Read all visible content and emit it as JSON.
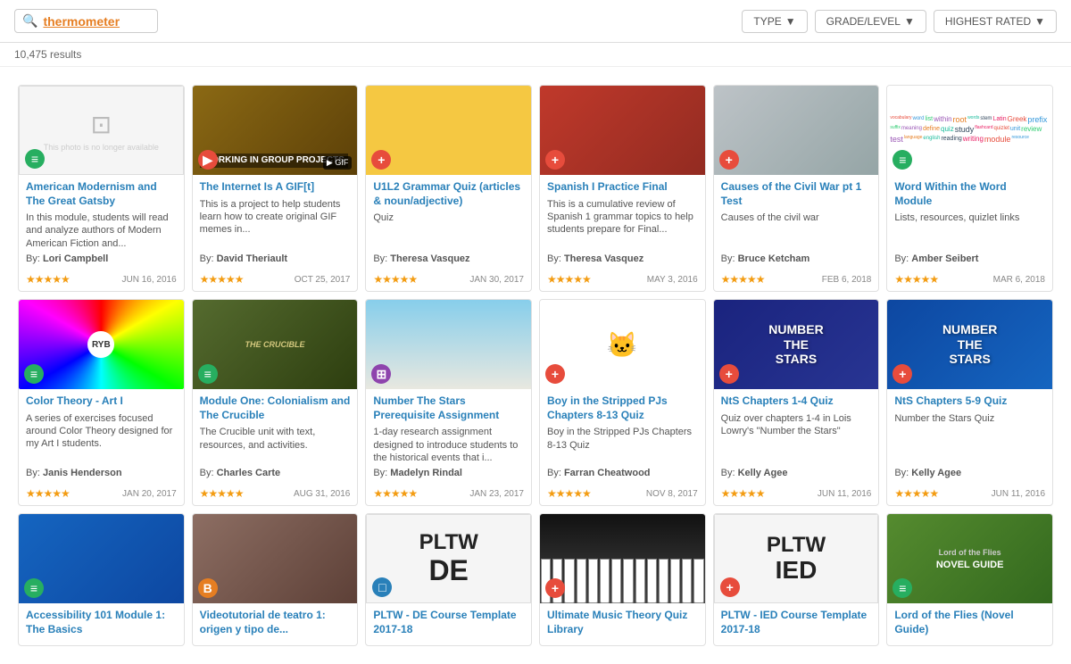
{
  "header": {
    "search_label": "thermometer",
    "search_icon": "🔍",
    "filters": [
      {
        "label": "TYPE",
        "icon": "▼"
      },
      {
        "label": "GRADE/LEVEL",
        "icon": "▼"
      },
      {
        "label": "HIGHEST RATED",
        "icon": "▼"
      }
    ]
  },
  "results_count": "10,475 results",
  "cards": [
    {
      "id": "card-1",
      "title": "American Modernism and The Great Gatsby",
      "desc": "In this module, students will read and analyze authors of Modern American Fiction and...",
      "author": "Lori Campbell",
      "date": "JUN 16, 2016",
      "stars": 5,
      "badge_type": "green",
      "badge_icon": "≡",
      "thumb_type": "no-image",
      "row": 1
    },
    {
      "id": "card-2",
      "title": "The Internet Is A GIF[t]",
      "desc": "This is a project to help students learn how to create original GIF memes in...",
      "author": "David Theriault",
      "date": "OCT 25, 2017",
      "stars": 5,
      "badge_type": "red",
      "badge_icon": "▶",
      "thumb_type": "brown",
      "thumb_text": "WORKING IN GROUP PROJECTS",
      "row": 1
    },
    {
      "id": "card-3",
      "title": "U1L2 Grammar Quiz (articles & noun/adjective)",
      "desc": "Quiz",
      "author": "Theresa Vasquez",
      "date": "JAN 30, 2017",
      "stars": 5,
      "badge_type": "red",
      "badge_icon": "⊕",
      "thumb_type": "orange",
      "row": 1
    },
    {
      "id": "card-4",
      "title": "Spanish I Practice Final",
      "desc": "This is a cumulative review of Spanish 1 grammar topics to help students prepare for Final...",
      "author": "Theresa Vasquez",
      "date": "MAY 3, 2016",
      "stars": 5,
      "badge_type": "red",
      "badge_icon": "⊕",
      "thumb_type": "rose",
      "row": 1
    },
    {
      "id": "card-5",
      "title": "Causes of the Civil War pt 1 Test",
      "desc": "Causes of the civil war",
      "author": "Bruce Ketcham",
      "date": "FEB 6, 2018",
      "stars": 5,
      "badge_type": "red",
      "badge_icon": "⊕",
      "thumb_type": "skeleton",
      "row": 1
    },
    {
      "id": "card-6",
      "title": "Word Within the Word Module",
      "desc": "Lists, resources, quizlet links",
      "author": "Amber Seibert",
      "date": "MAR 6, 2018",
      "stars": 5,
      "badge_type": "green",
      "badge_icon": "≡",
      "thumb_type": "wordcloud",
      "row": 1
    },
    {
      "id": "card-7",
      "title": "Color Theory - Art I",
      "desc": "A series of exercises focused around Color Theory designed for my Art I students.",
      "author": "Janis Henderson",
      "date": "JAN 20, 2017",
      "stars": 5,
      "badge_type": "green",
      "badge_icon": "≡",
      "thumb_type": "colorwheel",
      "row": 2
    },
    {
      "id": "card-8",
      "title": "Module One: Colonialism and The Crucible",
      "desc": "The Crucible unit with text, resources, and activities.",
      "author": "Charles Carte",
      "date": "AUG 31, 2016",
      "stars": 5,
      "badge_type": "green",
      "badge_icon": "≡",
      "thumb_type": "crucible",
      "row": 2
    },
    {
      "id": "card-9",
      "title": "Number The Stars Prerequisite Assignment",
      "desc": "1-day research assignment designed to introduce students to the historical events that i...",
      "author": "Madelyn Rindal",
      "date": "JAN 23, 2017",
      "stars": 5,
      "badge_type": "purple",
      "badge_icon": "⊞",
      "thumb_type": "field",
      "row": 2
    },
    {
      "id": "card-10",
      "title": "Boy in the Stripped PJs Chapters 8-13 Quiz",
      "desc": "Boy in the Stripped PJs Chapters 8-13 Quiz",
      "author": "Farran Cheatwood",
      "date": "NOV 8, 2017",
      "stars": 5,
      "badge_type": "red",
      "badge_icon": "⊕",
      "thumb_type": "bobcat",
      "row": 2
    },
    {
      "id": "card-11",
      "title": "NtS Chapters 1-4 Quiz",
      "desc": "Quiz over chapters 1-4 in Lois Lowry's \"Number the Stars\"",
      "author": "Kelly Agee",
      "date": "JUN 11, 2016",
      "stars": 5,
      "badge_type": "red",
      "badge_icon": "⊕",
      "thumb_type": "stars-field",
      "row": 2
    },
    {
      "id": "card-12",
      "title": "NtS Chapters 5-9 Quiz",
      "desc": "Number the Stars Quiz",
      "author": "Kelly Agee",
      "date": "JUN 11, 2016",
      "stars": 5,
      "badge_type": "red",
      "badge_icon": "⊕",
      "thumb_type": "stars-field2",
      "row": 2
    },
    {
      "id": "card-13",
      "title": "Accessibility 101 Module 1: The Basics",
      "desc": "",
      "author": "",
      "date": "",
      "stars": 0,
      "badge_type": "green",
      "badge_icon": "≡",
      "thumb_type": "accessibility",
      "row": 3
    },
    {
      "id": "card-14",
      "title": "Videotutorial de teatro 1: origen y tipo de...",
      "desc": "",
      "author": "",
      "date": "",
      "stars": 0,
      "badge_type": "orange",
      "badge_icon": "B",
      "thumb_type": "theater",
      "row": 3
    },
    {
      "id": "card-15",
      "title": "PLTW - DE Course Template 2017-18",
      "desc": "",
      "author": "",
      "date": "",
      "stars": 0,
      "badge_type": "blue",
      "badge_icon": "□",
      "thumb_type": "pltw-de",
      "thumb_text": "PLTW\nDE",
      "row": 3
    },
    {
      "id": "card-16",
      "title": "Ultimate Music Theory Quiz Library",
      "desc": "",
      "author": "",
      "date": "",
      "stars": 0,
      "badge_type": "red",
      "badge_icon": "⊕",
      "thumb_type": "piano",
      "row": 3
    },
    {
      "id": "card-17",
      "title": "PLTW - IED Course Template 2017-18",
      "desc": "",
      "author": "",
      "date": "",
      "stars": 0,
      "badge_type": "red",
      "badge_icon": "⊕",
      "thumb_type": "pltw-ied",
      "thumb_text": "PLTW\nIED",
      "row": 3
    },
    {
      "id": "card-18",
      "title": "Lord of the Flies (Novel Guide)",
      "desc": "",
      "author": "",
      "date": "",
      "stars": 0,
      "badge_type": "green",
      "badge_icon": "≡",
      "thumb_type": "lord-flies",
      "row": 3
    }
  ]
}
